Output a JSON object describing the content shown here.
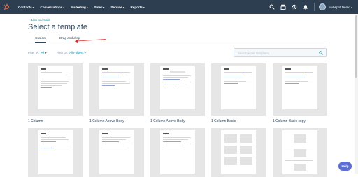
{
  "nav": {
    "items": [
      {
        "label": "Contacts"
      },
      {
        "label": "Conversations"
      },
      {
        "label": "Marketing"
      },
      {
        "label": "Sales"
      },
      {
        "label": "Service"
      },
      {
        "label": "Reports"
      }
    ],
    "username": "Hubspot Demo"
  },
  "page": {
    "back_link": "‹ Back to emails",
    "title": "Select a template",
    "tabs": [
      {
        "label": "Custom",
        "active": true
      },
      {
        "label": "Drag and drop",
        "active": false
      }
    ],
    "filters": {
      "filter_label": "Filter by:",
      "filter_value": "All ▾",
      "folder_label": "Filter by:",
      "folder_value": "All Folders ▾"
    },
    "search_placeholder": "Search email templates"
  },
  "templates": [
    {
      "label": "1 Column"
    },
    {
      "label": "1 Column Above Body"
    },
    {
      "label": "1 Column Above Body"
    },
    {
      "label": "1 Column Basic"
    },
    {
      "label": "1 Column Basic copy"
    },
    {
      "label": ""
    },
    {
      "label": ""
    },
    {
      "label": ""
    },
    {
      "label": ""
    },
    {
      "label": ""
    }
  ],
  "help_label": "Help",
  "colors": {
    "nav_bg": "#2d3e50",
    "link": "#0091ae",
    "annotation_arrow": "#e0262a",
    "help_bg": "#5d6fd2"
  }
}
